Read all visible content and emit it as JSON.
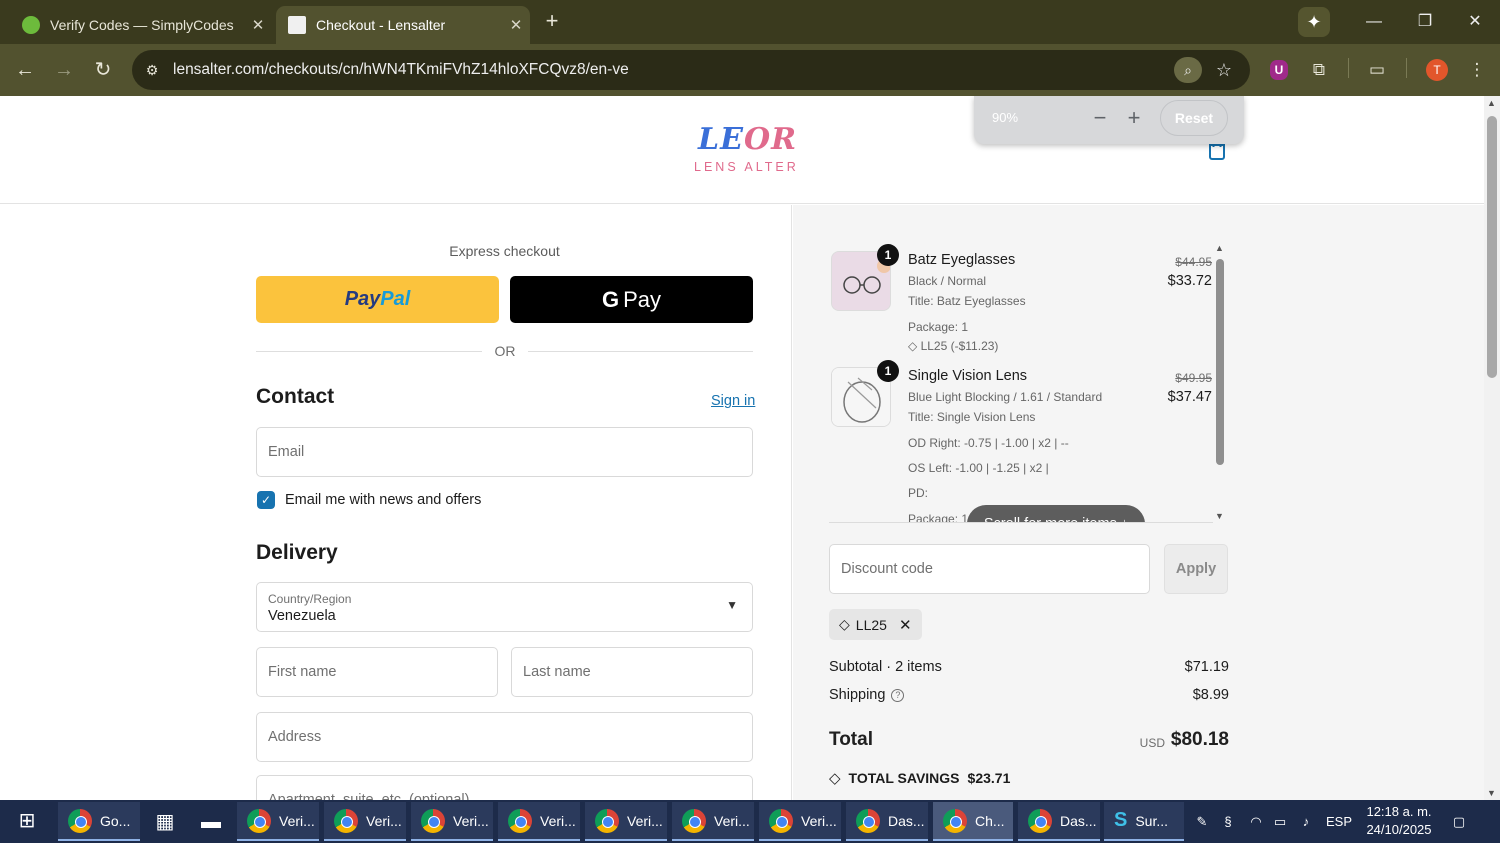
{
  "browser": {
    "tabs": [
      {
        "title": "Verify Codes — SimplyCodes",
        "close": "✕"
      },
      {
        "title": "Checkout - Lensalter",
        "close": "✕"
      }
    ],
    "new_tab": "+",
    "url": "lensalter.com/checkouts/cn/hWN4TKmiFVhZ14hloXFCQvz8/en-ve",
    "profile_initial": "T",
    "extension_initial": "U",
    "zoom_popup": {
      "percent": "90%",
      "minus": "−",
      "plus": "+",
      "reset": "Reset"
    }
  },
  "store": {
    "logo_mark_blue": "LE",
    "logo_mark_pink": "OR",
    "logo_wordmark": "LENS ALTER"
  },
  "checkout": {
    "express_label": "Express checkout",
    "paypal_a": "Pay",
    "paypal_b": "Pal",
    "gpay_g": "G",
    "gpay_label": "Pay",
    "or_label": "OR",
    "contact_heading": "Contact",
    "sign_in": "Sign in",
    "email_placeholder": "Email",
    "newsletter_label": "Email me with news and offers",
    "delivery_heading": "Delivery",
    "country_label": "Country/Region",
    "country_value": "Venezuela",
    "first_name_placeholder": "First name",
    "last_name_placeholder": "Last name",
    "address_placeholder": "Address",
    "apartment_placeholder": "Apartment, suite, etc. (optional)"
  },
  "summary": {
    "items": [
      {
        "qty": "1",
        "name": "Batz Eyeglasses",
        "variant": "Black / Normal",
        "title_line": "Title: Batz Eyeglasses",
        "package": "Package: 1",
        "discount": "LL25 (-$11.23)",
        "old_price": "$44.95",
        "price": "$33.72"
      },
      {
        "qty": "1",
        "name": "Single Vision Lens",
        "variant": "Blue Light Blocking / 1.61 / Standard",
        "title_line": "Title: Single Vision Lens",
        "od": "OD Right: -0.75 | -1.00 | x2 | --",
        "os": "OS Left: -1.00 | -1.25 | x2 |",
        "pd": "PD: ",
        "package": "Package: 1",
        "old_price": "$49.95",
        "price": "$37.47"
      }
    ],
    "scroll_hint": "Scroll for more items ↓",
    "discount_placeholder": "Discount code",
    "apply_label": "Apply",
    "applied_code": "LL25",
    "subtotal_label": "Subtotal · 2 items",
    "subtotal_value": "$71.19",
    "shipping_label": "Shipping",
    "shipping_value": "$8.99",
    "total_label": "Total",
    "currency": "USD",
    "total_value": "$80.18",
    "savings_label": "TOTAL SAVINGS",
    "savings_value": "$23.71"
  },
  "taskbar": {
    "apps": [
      {
        "label": "Go...",
        "active": false
      },
      {
        "label": "Veri...",
        "active": false
      },
      {
        "label": "Veri...",
        "active": false
      },
      {
        "label": "Veri...",
        "active": false
      },
      {
        "label": "Veri...",
        "active": false
      },
      {
        "label": "Veri...",
        "active": false
      },
      {
        "label": "Veri...",
        "active": false
      },
      {
        "label": "Veri...",
        "active": false
      },
      {
        "label": "Das...",
        "active": false
      },
      {
        "label": "Ch...",
        "active": true
      },
      {
        "label": "Das...",
        "active": false
      },
      {
        "label": "Sur...",
        "active": false
      }
    ],
    "language": "ESP",
    "time": "12:18 a. m.",
    "date": "24/10/2025"
  },
  "colors": {
    "accent": "#1773b0",
    "paypal": "#fbc33d",
    "chrome": "#52522f"
  }
}
